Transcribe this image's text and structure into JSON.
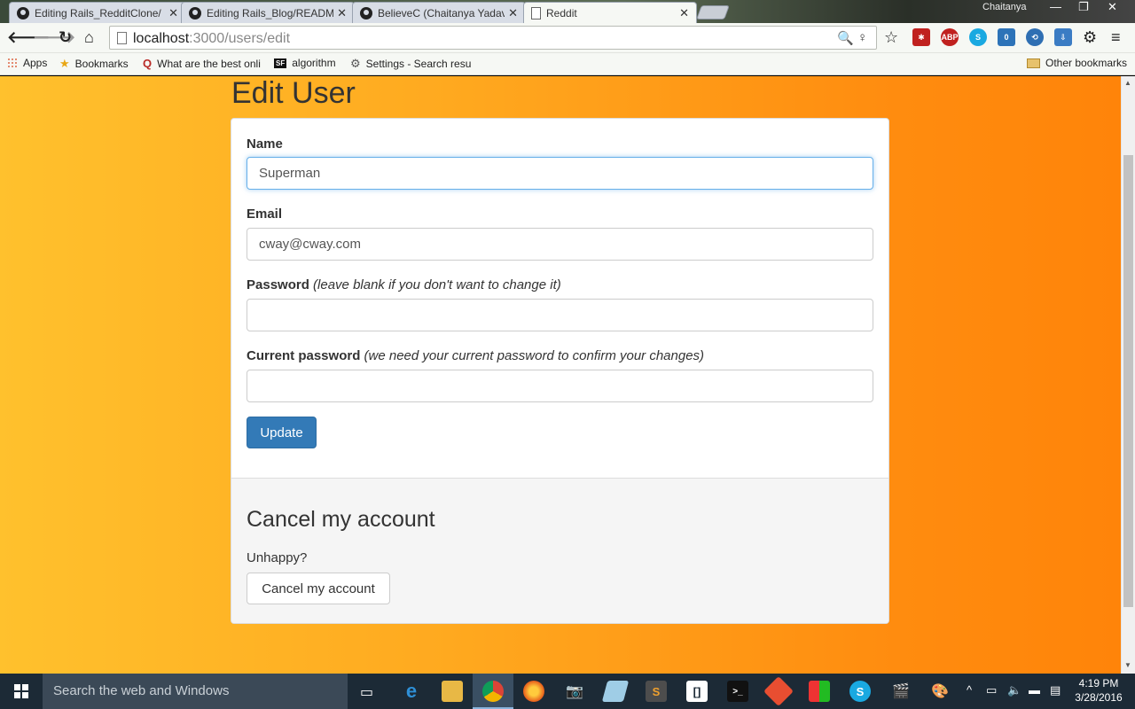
{
  "browser": {
    "tabs": [
      {
        "title": "Editing Rails_RedditClone/",
        "icon": "github-icon",
        "active": false
      },
      {
        "title": "Editing Rails_Blog/READM",
        "icon": "github-icon",
        "active": false
      },
      {
        "title": "BelieveC (Chaitanya Yadav",
        "icon": "github-icon",
        "active": false
      },
      {
        "title": "Reddit",
        "icon": "page-icon",
        "active": true
      }
    ],
    "window_user": "Chaitanya",
    "url_host": "localhost",
    "url_path": ":3000/users/edit",
    "bookmarks": [
      {
        "label": "Apps",
        "icon": "apps-grid-icon"
      },
      {
        "label": "Bookmarks",
        "icon": "star-icon"
      },
      {
        "label": "What are the best onli",
        "icon": "quora-icon"
      },
      {
        "label": "algorithm",
        "icon": "sf-icon"
      },
      {
        "label": "Settings - Search resu",
        "icon": "gear-icon"
      }
    ],
    "other_bookmarks": "Other bookmarks",
    "extensions": {
      "abp": "ABP",
      "badge": "0"
    }
  },
  "page": {
    "title": "Edit User",
    "form": {
      "name_label": "Name",
      "name_value": "Superman",
      "email_label": "Email",
      "email_value": "cway@cway.com",
      "password_label": "Password",
      "password_hint": "(leave blank if you don't want to change it)",
      "current_password_label": "Current password",
      "current_password_hint": "(we need your current password to confirm your changes)",
      "update_button": "Update"
    },
    "cancel": {
      "heading": "Cancel my account",
      "text": "Unhappy?",
      "button": "Cancel my account"
    },
    "background_colors": [
      "#ffc12d",
      "#ff8409"
    ],
    "primary_button_color": "#337ab7"
  },
  "taskbar": {
    "search_placeholder": "Search the web and Windows",
    "time": "4:19 PM",
    "date": "3/28/2016"
  }
}
